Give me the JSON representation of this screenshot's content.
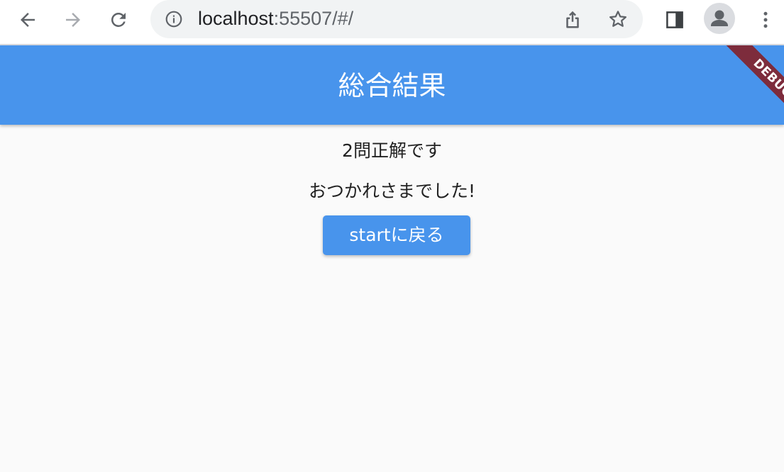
{
  "browser": {
    "url_host": "localhost",
    "url_rest": ":55507/#/",
    "icons": [
      "back-arrow-icon",
      "forward-arrow-icon",
      "reload-icon",
      "info-icon",
      "share-icon",
      "star-icon",
      "side-panel-icon",
      "profile-icon",
      "more-vert-icon"
    ],
    "colors": {
      "toolbar": "#ffffff",
      "omnibox": "#f1f3f4",
      "icon": "#5f6368",
      "icon_disabled": "#a8abb0"
    }
  },
  "app_bar": {
    "title": "総合結果",
    "debug_label": "DEBUG",
    "colors": {
      "background": "#4894ec",
      "debug_banner": "#7d2c3c"
    }
  },
  "main": {
    "score_text": "2問正解です",
    "message_text": "おつかれさまでした!",
    "back_button_label": "startに戻る",
    "colors": {
      "background": "#fafafa",
      "text": "#212121",
      "button": "#4894ec"
    }
  }
}
